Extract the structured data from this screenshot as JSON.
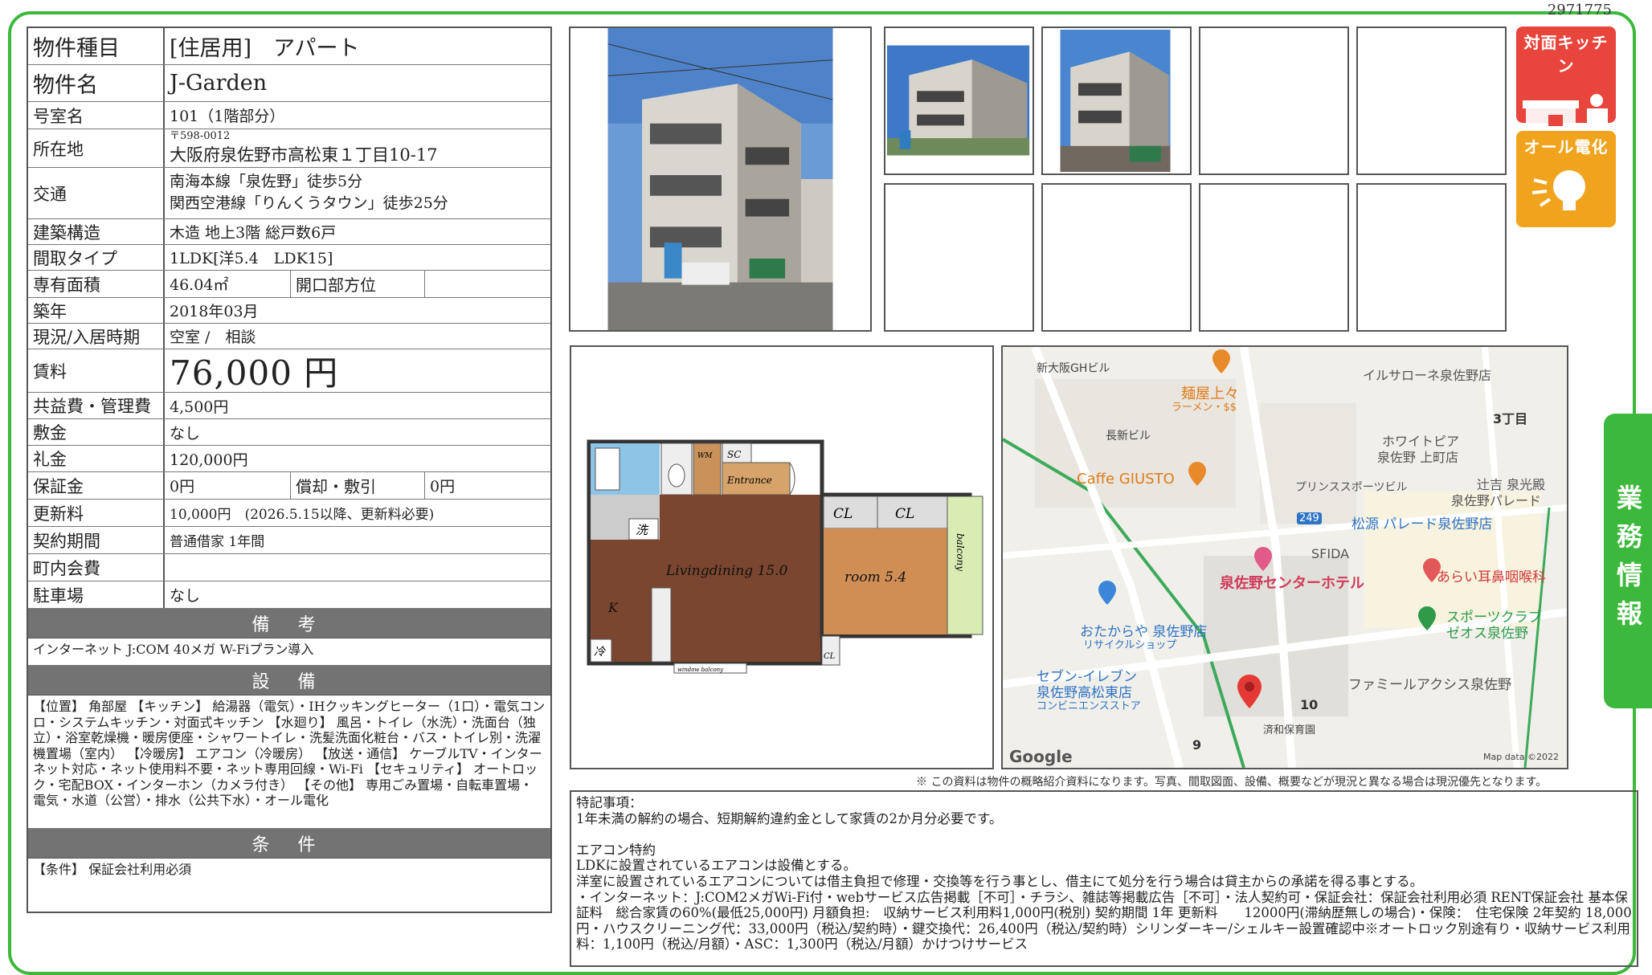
{
  "property_id": "2971775",
  "rows": {
    "type": {
      "label": "物件種目",
      "value": "[住居用]　アパート"
    },
    "name": {
      "label": "物件名",
      "value": "J-Garden"
    },
    "room": {
      "label": "号室名",
      "value": "101（1階部分）"
    },
    "address": {
      "label": "所在地",
      "postal": "〒598-0012",
      "value": "大阪府泉佐野市高松東１丁目10-17"
    },
    "transport": {
      "label": "交通",
      "line1": "南海本線「泉佐野」徒歩5分",
      "line2": "関西空港線「りんくうタウン」徒歩25分"
    },
    "structure": {
      "label": "建築構造",
      "value": "木造 地上3階 総戸数6戸"
    },
    "layout": {
      "label": "間取タイプ",
      "value": "1LDK[洋5.4　LDK15]"
    },
    "area": {
      "label": "専有面積",
      "value": "46.04㎡",
      "sub_label": "開口部方位",
      "sub_value": ""
    },
    "built": {
      "label": "築年",
      "value": "2018年03月"
    },
    "status": {
      "label": "現況/入居時期",
      "value": "空室 /　相談"
    },
    "rent": {
      "label": "賃料",
      "value": "76,000 円"
    },
    "fee": {
      "label": "共益費・管理費",
      "value": "4,500円"
    },
    "deposit": {
      "label": "敷金",
      "value": "なし"
    },
    "key_money": {
      "label": "礼金",
      "value": "120,000円"
    },
    "guarantee": {
      "label": "保証金",
      "value": "0円",
      "sub_label": "償却・敷引",
      "sub_value": "0円"
    },
    "renewal": {
      "label": "更新料",
      "value": "10,000円　(2026.5.15以降、更新料必要)"
    },
    "contract": {
      "label": "契約期間",
      "value": "普通借家 1年間"
    },
    "community": {
      "label": "町内会費",
      "value": ""
    },
    "parking": {
      "label": "駐車場",
      "value": "なし"
    }
  },
  "sections": {
    "remarks_title": "備 考",
    "remarks_text": "インターネット J:COM 40メガ W-Fiプラン導入",
    "equipment_title": "設 備",
    "equipment_text": "【位置】 角部屋 【キッチン】 給湯器（電気）・IHクッキングヒーター（1口）・電気コンロ・システムキッチン・対面式キッチン 【水廻り】 風呂・トイレ（水洗）・洗面台（独立）・浴室乾燥機・暖房便座・シャワートイレ・洗髪洗面化粧台・バス・トイレ別・洗濯機置場（室内） 【冷暖房】 エアコン（冷暖房） 【放送・通信】 ケーブルTV・インターネット対応・ネット使用料不要・ネット専用回線・Wi-Fi 【セキュリティ】 オートロック・宅配BOX・インターホン（カメラ付き） 【その他】 専用ごみ置場・自転車置場・電気・水道（公営）・排水（公共下水）・オール電化",
    "conditions_title": "条 件",
    "conditions_text": "【条件】 保証会社利用必須"
  },
  "badges": {
    "kitchen": "対面キッチン",
    "electric": "オール電化"
  },
  "floorplan": {
    "sc": "SC",
    "entrance": "Entrance",
    "cl1": "CL",
    "cl2": "CL",
    "balcony": "balcony",
    "living": "Livingdining  15.0",
    "room": "room  5.4",
    "kitchen": "K",
    "wash": "洗",
    "fridge": "冷",
    "cl3": "CL",
    "window": "window balcony",
    "wm": "WM"
  },
  "map": {
    "labels": [
      "新大阪GHビル",
      "麺屋上々",
      "ラーメン・$$",
      "イルサローネ泉佐野店",
      "3丁目",
      "長新ビル",
      "ホワイトピア",
      "泉佐野 上町店",
      "Caffe GIUSTO",
      "プリンススポーツビル",
      "辻吉 泉光殿",
      "泉佐野パレード",
      "249",
      "松源 パレード泉佐野店",
      "SFIDA",
      "泉佐野センターホテル",
      "あらい耳鼻咽喉科",
      "おたからや 泉佐野店",
      "リサイクルショップ",
      "スポーツクラブ",
      "ゼオス泉佐野",
      "セブン-イレブン",
      "泉佐野高松東店",
      "コンビニエンスストア",
      "ファミールアクシス泉佐野",
      "10",
      "済和保育園",
      "9",
      "Google",
      "Map data ©2022"
    ]
  },
  "disclaimer": "※ この資料は物件の概略紹介資料になります。写真、間取図面、設備、概要などが現況と異なる場合は現況優先となります。",
  "special_notes": "特記事項：\n1年未満の解約の場合、短期解約違約金として家賃の2か月分必要です。\n\nエアコン特約\nLDKに設置されているエアコンは設備とする。\n洋室に設置されているエアコンについては借主負担で修理・交換等を行う事とし、借主にて処分を行う場合は貸主からの承諾を得る事とする。\n・インターネット：J:COM2メガWi-Fi付・webサービス広告掲載［不可］・チラシ、雑誌等掲載広告［不可］・法人契約可・保証会社：保証会社利用必須 RENT保証会社 基本保証料　総合家賃の60%(最低25,000円) 月額負担:　収納サービス利用料1,000円(税別) 契約期間 1年 更新料　　12000円(滞納歴無しの場合)・保険：　住宅保険 2年契約 18,000円・ハウスクリーニング代：33,000円（税込/契約時）・鍵交換代：26,400円（税込/契約時）シリンダーキー/シェルキー設置確認中※オートロック別途有り・収納サービス利用料：1,100円（税込/月額）・ASC：1,300円（税込/月額）かけつけサービス",
  "side_tab": "業務情報",
  "colors": {
    "frame": "#3cb83c",
    "banner": "#737373",
    "kitchen_badge": "#e8453c",
    "electric_badge": "#f0a31c",
    "rent_text": "#222222"
  }
}
